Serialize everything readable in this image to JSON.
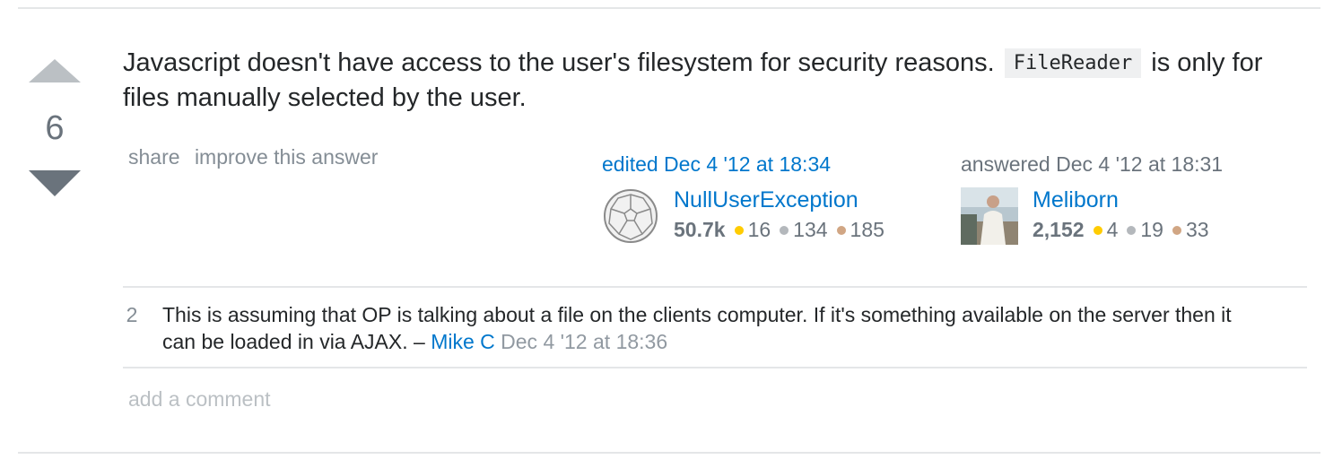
{
  "vote": {
    "count": "6",
    "up_icon": "upvote-arrow-icon",
    "down_icon": "downvote-arrow-icon"
  },
  "post": {
    "text_before": "Javascript doesn't have access to the user's filesystem for security reasons.",
    "code": "FileReader",
    "text_after": "is only for files manually selected by the user."
  },
  "menu": {
    "share": "share",
    "improve": "improve this answer"
  },
  "edited": {
    "action": "edited Dec 4 '12 at 18:34",
    "user": "NullUserException",
    "rep": "50.7k",
    "gold": "16",
    "silver": "134",
    "bronze": "185"
  },
  "answered": {
    "action": "answered Dec 4 '12 at 18:31",
    "user": "Meliborn",
    "rep": "2,152",
    "gold": "4",
    "silver": "19",
    "bronze": "33"
  },
  "comments": [
    {
      "score": "2",
      "text": "This is assuming that OP is talking about a file on the clients computer. If it's something available on the server then it can be loaded in via AJAX. –",
      "user": "Mike C",
      "date": "Dec 4 '12 at 18:36"
    }
  ],
  "add_comment": "add a comment",
  "colors": {
    "link": "#0077cc",
    "muted": "#6a737c",
    "gold": "#ffcc01",
    "silver": "#b4b8bc",
    "bronze": "#d1a684"
  }
}
